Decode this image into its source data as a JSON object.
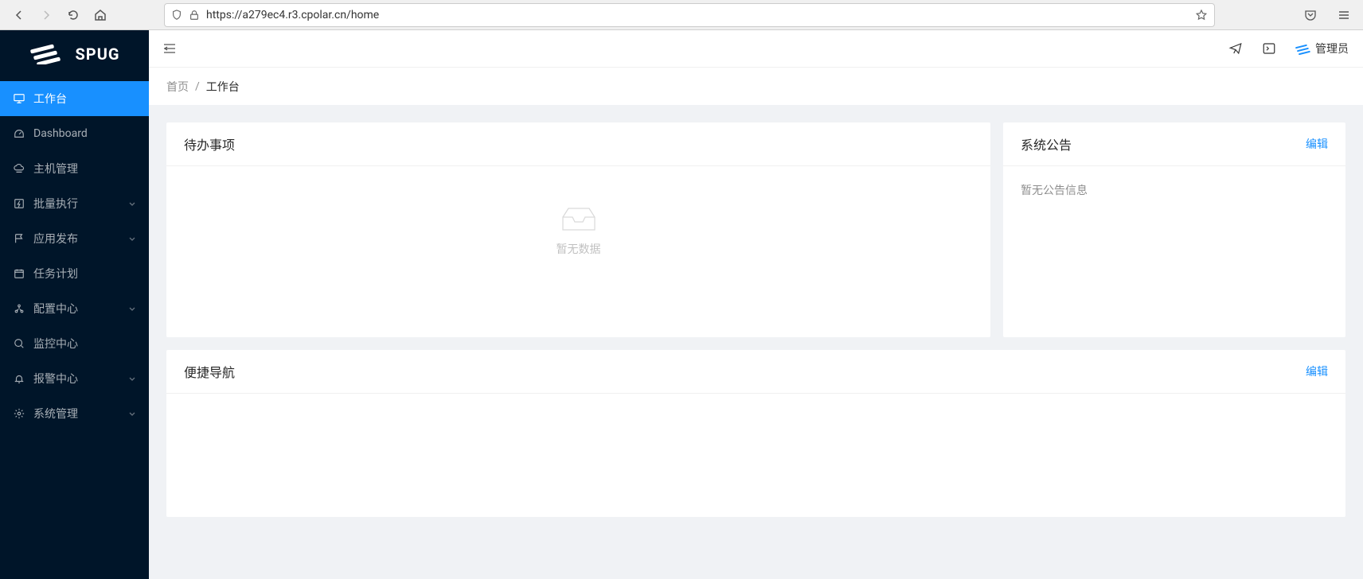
{
  "browser": {
    "url": "https://a279ec4.r3.cpolar.cn/home"
  },
  "logo": {
    "text": "SPUG"
  },
  "sidebar": {
    "items": [
      {
        "label": "工作台",
        "icon": "desktop-icon",
        "active": true,
        "expandable": false
      },
      {
        "label": "Dashboard",
        "icon": "dashboard-icon",
        "active": false,
        "expandable": false
      },
      {
        "label": "主机管理",
        "icon": "cloud-server-icon",
        "active": false,
        "expandable": false
      },
      {
        "label": "批量执行",
        "icon": "thunderbolt-icon",
        "active": false,
        "expandable": true
      },
      {
        "label": "应用发布",
        "icon": "flag-icon",
        "active": false,
        "expandable": true
      },
      {
        "label": "任务计划",
        "icon": "schedule-icon",
        "active": false,
        "expandable": false
      },
      {
        "label": "配置中心",
        "icon": "deployment-icon",
        "active": false,
        "expandable": true
      },
      {
        "label": "监控中心",
        "icon": "monitor-icon",
        "active": false,
        "expandable": false
      },
      {
        "label": "报警中心",
        "icon": "alert-icon",
        "active": false,
        "expandable": true
      },
      {
        "label": "系统管理",
        "icon": "setting-icon",
        "active": false,
        "expandable": true
      }
    ]
  },
  "topbar": {
    "user_label": "管理员"
  },
  "breadcrumb": {
    "home": "首页",
    "current": "工作台"
  },
  "cards": {
    "todo": {
      "title": "待办事项",
      "empty_text": "暂无数据"
    },
    "announce": {
      "title": "系统公告",
      "edit": "编辑",
      "empty_text": "暂无公告信息"
    },
    "quicknav": {
      "title": "便捷导航",
      "edit": "编辑"
    }
  }
}
